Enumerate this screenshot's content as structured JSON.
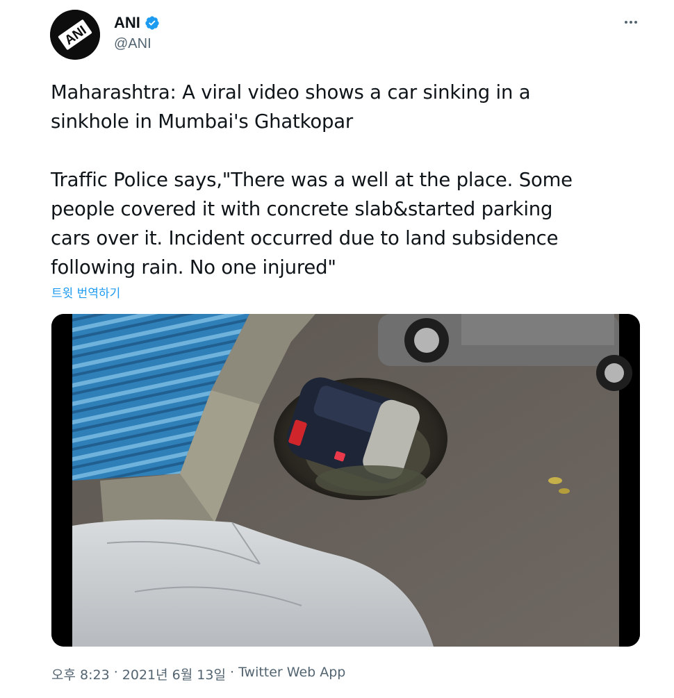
{
  "author": {
    "display_name": "ANI",
    "handle": "@ANI",
    "avatar_text": "ANI",
    "verified_icon": "verified-badge-icon"
  },
  "more_icon": "more-horizontal-icon",
  "tweet": {
    "paragraph_1": "Maharashtra: A viral video shows a car sinking in a\nsinkhole in Mumbai's Ghatkopar",
    "paragraph_2": "Traffic Police says,\"There was a well at the place. Some\npeople covered it with concrete slab&started parking\ncars over it. Incident occurred due to land subsidence\nfollowing rain. No one injured\"",
    "translate_label": "트윗 번역하기"
  },
  "meta": {
    "time": "오후 8:23",
    "separator_1": " · ",
    "date": "2021년 6월 13일",
    "separator_2": " · ",
    "source": "Twitter Web App"
  },
  "colors": {
    "accent": "#1d9bf0",
    "secondary_text": "#536471",
    "primary_text": "#0f1419"
  }
}
